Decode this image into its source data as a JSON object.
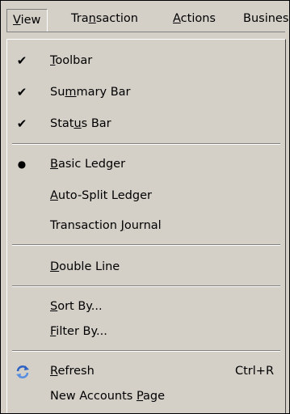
{
  "menubar": {
    "items": [
      {
        "pre": "",
        "key": "V",
        "post": "iew"
      },
      {
        "pre": "Tra",
        "key": "n",
        "post": "saction"
      },
      {
        "pre": "",
        "key": "A",
        "post": "ctions"
      },
      {
        "pre": "Busines",
        "key": "",
        "post": ""
      }
    ]
  },
  "menu": {
    "items": [
      {
        "pre": "",
        "key": "T",
        "post": "oolbar",
        "mark": "✔"
      },
      {
        "pre": "Su",
        "key": "m",
        "post": "mary Bar",
        "mark": "✔"
      },
      {
        "pre": "Stat",
        "key": "u",
        "post": "s Bar",
        "mark": "✔"
      },
      {
        "pre": "",
        "key": "B",
        "post": "asic Ledger",
        "mark": "●"
      },
      {
        "pre": "",
        "key": "A",
        "post": "uto-Split Ledger"
      },
      {
        "pre": "Transaction ",
        "key": "J",
        "post": "ournal"
      },
      {
        "pre": "",
        "key": "D",
        "post": "ouble Line"
      },
      {
        "pre": "",
        "key": "S",
        "post": "ort By..."
      },
      {
        "pre": "",
        "key": "F",
        "post": "ilter By..."
      },
      {
        "pre": "",
        "key": "R",
        "post": "efresh",
        "accel": "Ctrl+R",
        "icon": "refresh-icon"
      },
      {
        "pre": "New Accounts ",
        "key": "P",
        "post": "age"
      }
    ]
  },
  "colors": {
    "menu_face": "#d4d0c8",
    "shadow": "#808080",
    "highlight": "#ffffff",
    "refresh_icon_blue": "#2d62c4"
  }
}
